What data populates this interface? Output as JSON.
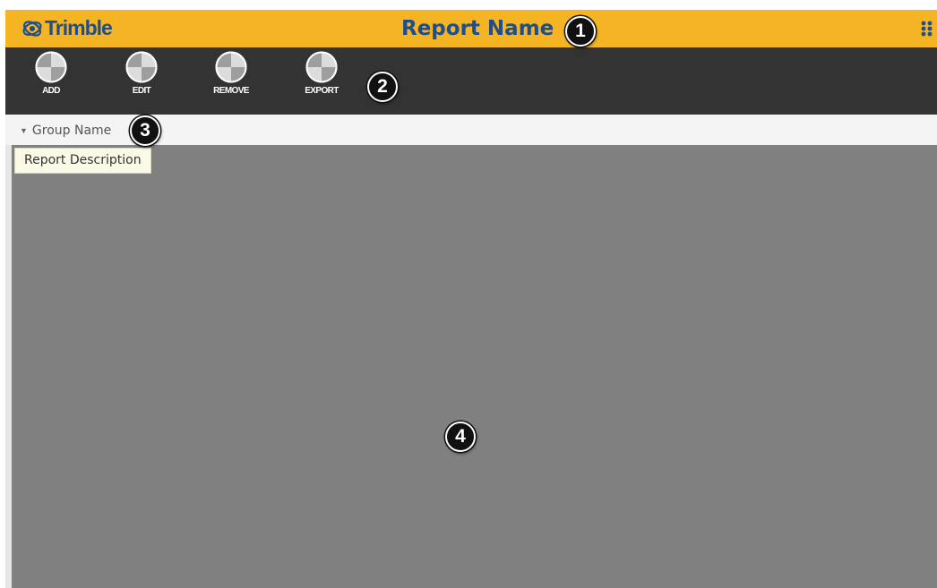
{
  "header": {
    "brand": "Trimble",
    "report_title": "Report Name",
    "apps_icon": "apps-grid-icon",
    "background_color": "#f5b423",
    "brand_color": "#1e4e8c"
  },
  "toolbar": {
    "background_color": "#333333",
    "buttons": [
      {
        "label": "ADD",
        "icon": "placeholder-circle-icon"
      },
      {
        "label": "EDIT",
        "icon": "placeholder-circle-icon"
      },
      {
        "label": "REMOVE",
        "icon": "placeholder-circle-icon"
      },
      {
        "label": "EXPORT",
        "icon": "placeholder-circle-icon"
      }
    ]
  },
  "group": {
    "caret_icon": "triangle-down-icon",
    "name": "Group Name",
    "expanded": true
  },
  "tooltip": {
    "text": "Report Description"
  },
  "content": {
    "background_color": "#808080"
  },
  "callouts": [
    "1",
    "2",
    "3",
    "4"
  ]
}
